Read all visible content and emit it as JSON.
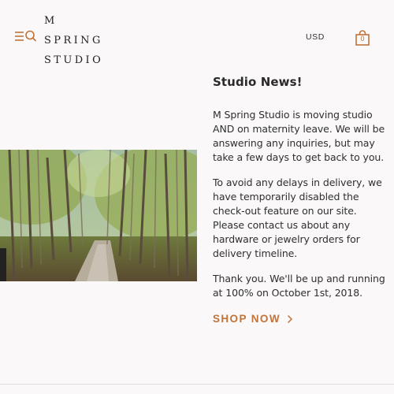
{
  "header": {
    "menu_icon": "hamburger-icon",
    "search_icon": "search-icon",
    "logo_lines": [
      "M",
      "SPRING",
      "STUDIO"
    ],
    "currency": "USD",
    "cart_icon": "shopping-bag-icon",
    "cart_count": "0"
  },
  "colors": {
    "accent": "#c0733a",
    "background": "#faf8f8"
  },
  "feature_image": {
    "subject": "forest-road-photo"
  },
  "content": {
    "title": "Studio News!",
    "paragraphs": [
      "M Spring Studio is moving studio AND on maternity leave. We will be answering any inquiries, but may take a few days to get back to you.",
      "To avoid any delays in delivery, we have temporarily disabled the check-out feature on our site. Please contact us about any hardware or jewelry orders for delivery timeline.",
      "Thank you. We'll be up and running at 100% on October 1st, 2018."
    ],
    "cta_label": "SHOP NOW",
    "cta_icon": "chevron-right-icon"
  }
}
